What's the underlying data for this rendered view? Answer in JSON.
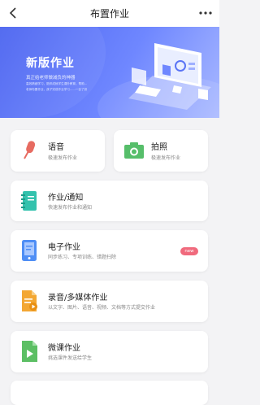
{
  "header": {
    "title": "布置作业",
    "back_icon": "chevron-left-icon",
    "more_icon": "more-dots-icon"
  },
  "banner": {
    "title": "新版作业",
    "subtitle": "真正给老师做减负的神器",
    "small_lines": [
      "高效精细学习，陪伴成就学生课外教育，帮助...",
      "老师布置作业，孩子完成作业学习......一目了然"
    ]
  },
  "cards": {
    "voice": {
      "label": "语音",
      "desc": "极速发布作业",
      "icon": "microphone-icon",
      "color": "#e76b61"
    },
    "photo": {
      "label": "拍照",
      "desc": "极速发布作业",
      "icon": "camera-icon",
      "color": "#56be6a"
    },
    "notice": {
      "label": "作业/通知",
      "desc": "快速发布作业和通知",
      "icon": "notebook-icon",
      "color": "#33c2ad"
    },
    "electronic": {
      "label": "电子作业",
      "desc": "同步练习、专项训练、错题扫除",
      "icon": "tablet-icon",
      "color": "#4f8ef5",
      "badge": "new"
    },
    "media": {
      "label": "录音/多媒体作业",
      "desc": "以文字、图片、语音、视频、文档等方式提交作业",
      "icon": "document-icon",
      "color": "#f3a733"
    },
    "micro": {
      "label": "微课作业",
      "desc": "挑选课件发送给学生",
      "icon": "video-file-icon",
      "color": "#5cbf64"
    }
  }
}
